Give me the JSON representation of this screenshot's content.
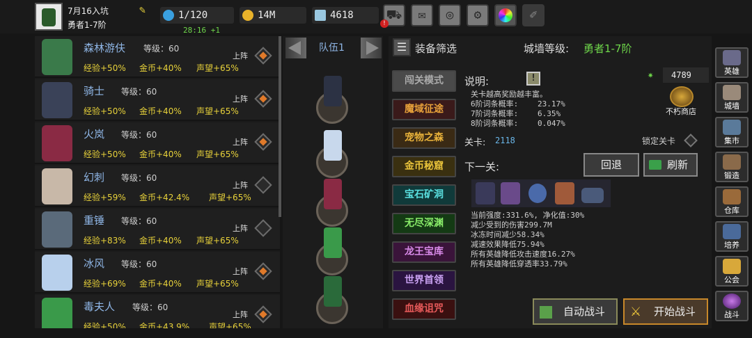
{
  "player": {
    "name": "7月16入坑",
    "title": "勇者1-7阶"
  },
  "stats": {
    "energy": "1/120",
    "timer": "28:16 +1",
    "gold": "14M",
    "gems": "4618"
  },
  "heroes": [
    {
      "name": "森林游伕",
      "level": "等级：60",
      "exp": "经验+50%",
      "gold": "金币+40%",
      "rep": "声望+65%",
      "deploy": "上阵",
      "deployed": true
    },
    {
      "name": "骑士",
      "level": "等级：60",
      "exp": "经验+50%",
      "gold": "金币+40%",
      "rep": "声望+65%",
      "deploy": "上阵",
      "deployed": true
    },
    {
      "name": "火岚",
      "level": "等级：60",
      "exp": "经验+50%",
      "gold": "金币+40%",
      "rep": "声望+65%",
      "deploy": "上阵",
      "deployed": true
    },
    {
      "name": "幻刺",
      "level": "等级：60",
      "exp": "经验+59%",
      "gold": "金币+42.4%",
      "rep": "声望+65%",
      "deploy": "上阵",
      "deployed": false
    },
    {
      "name": "重锤",
      "level": "等级：60",
      "exp": "经验+83%",
      "gold": "金币+40%",
      "rep": "声望+65%",
      "deploy": "上阵",
      "deployed": false
    },
    {
      "name": "冰风",
      "level": "等级：60",
      "exp": "经验+69%",
      "gold": "金币+40%",
      "rep": "声望+65%",
      "deploy": "上阵",
      "deployed": true
    },
    {
      "name": "毒夫人",
      "level": "等级：60",
      "exp": "经验+50%",
      "gold": "金币+43.9%",
      "rep": "声望+65%",
      "deploy": "上阵",
      "deployed": true
    }
  ],
  "team": {
    "label": "队伍1"
  },
  "filter": {
    "label": "装备筛选",
    "wall_label": "城墙等级:",
    "wall_value": "勇者1-7阶"
  },
  "modes": [
    "闯关模式",
    "魔域征途",
    "宠物之森",
    "金币秘窟",
    "宝石矿洞",
    "无尽深渊",
    "龙王宝库",
    "世界首领",
    "血缘诅咒"
  ],
  "info": {
    "title": "说明:",
    "line1": "关卡越高奖励越丰富。",
    "rates": [
      {
        "label": "6阶词条概率:",
        "value": "23.17%"
      },
      {
        "label": "7阶词条概率:",
        "value": "6.35%"
      },
      {
        "label": "8阶词条概率:",
        "value": "0.047%"
      }
    ],
    "stage_label": "关卡:",
    "stage_value": "2118",
    "lock_label": "锁定关卡",
    "crystal_count": "4789",
    "shop_label": "不朽商店",
    "next_label": "下一关:",
    "back_label": "回退",
    "refresh_label": "刷新",
    "details": [
      "当前强度:331.6%, 净化值:30%",
      "减少受到的伤害299.7M",
      "冰冻时间减少58.34%",
      "减速效果降低75.94%",
      "所有英雄降低攻击速度16.27%",
      "所有英雄降低穿透率33.79%"
    ],
    "auto_label": "自动战斗",
    "start_label": "开始战斗"
  },
  "sidebar": [
    "英雄",
    "城墙",
    "集市",
    "锻造",
    "仓库",
    "培养",
    "公会",
    "战斗"
  ],
  "colors": {
    "accent_yellow": "#e8d23a",
    "accent_green": "#6ed64a",
    "name_blue": "#8fb6e6"
  }
}
